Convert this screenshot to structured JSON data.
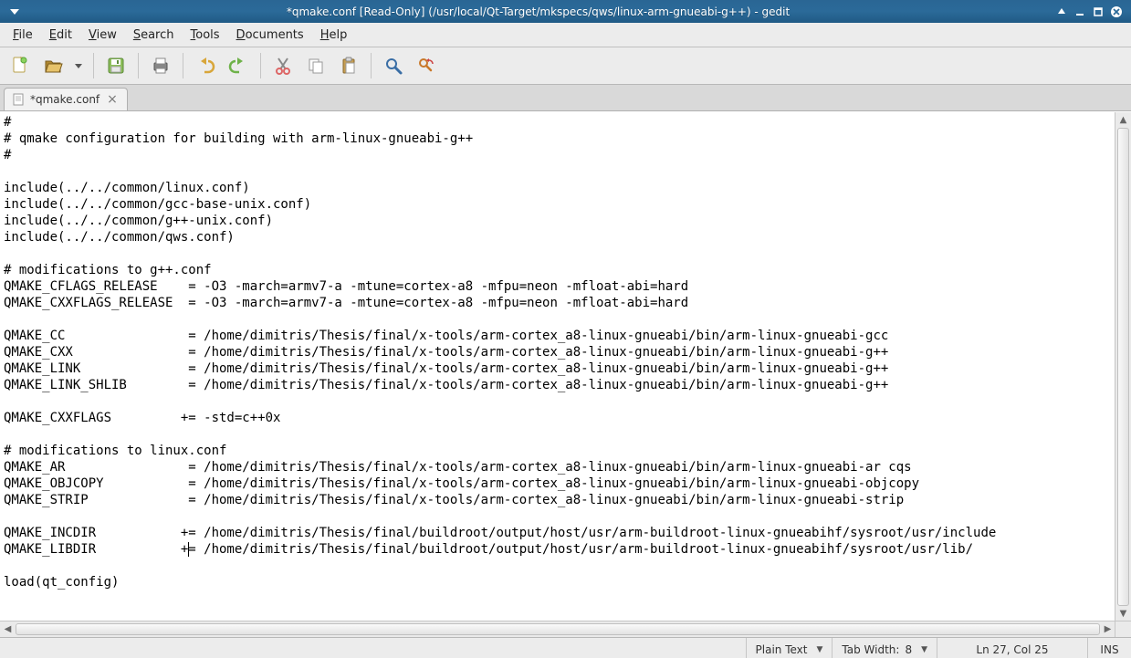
{
  "titlebar": {
    "title": "*qmake.conf [Read-Only] (/usr/local/Qt-Target/mkspecs/qws/linux-arm-gnueabi-g++) - gedit"
  },
  "menubar": {
    "items": [
      {
        "label": "File",
        "accel": "F"
      },
      {
        "label": "Edit",
        "accel": "E"
      },
      {
        "label": "View",
        "accel": "V"
      },
      {
        "label": "Search",
        "accel": "S"
      },
      {
        "label": "Tools",
        "accel": "T"
      },
      {
        "label": "Documents",
        "accel": "D"
      },
      {
        "label": "Help",
        "accel": "H"
      }
    ]
  },
  "toolbar": {
    "buttons": [
      {
        "name": "new-file-button",
        "icon": "new-file-icon"
      },
      {
        "name": "open-file-button",
        "icon": "open-file-icon",
        "dropdown": true
      },
      {
        "name": "sep"
      },
      {
        "name": "save-button",
        "icon": "save-icon"
      },
      {
        "name": "sep"
      },
      {
        "name": "print-button",
        "icon": "print-icon"
      },
      {
        "name": "sep"
      },
      {
        "name": "undo-button",
        "icon": "undo-icon"
      },
      {
        "name": "redo-button",
        "icon": "redo-icon"
      },
      {
        "name": "sep"
      },
      {
        "name": "cut-button",
        "icon": "cut-icon"
      },
      {
        "name": "copy-button",
        "icon": "copy-icon"
      },
      {
        "name": "paste-button",
        "icon": "paste-icon"
      },
      {
        "name": "sep"
      },
      {
        "name": "find-button",
        "icon": "find-icon"
      },
      {
        "name": "find-replace-button",
        "icon": "find-replace-icon"
      }
    ]
  },
  "tabs": {
    "items": [
      {
        "label": "*qmake.conf"
      }
    ]
  },
  "editor": {
    "lines": [
      "#",
      "# qmake configuration for building with arm-linux-gnueabi-g++",
      "#",
      "",
      "include(../../common/linux.conf)",
      "include(../../common/gcc-base-unix.conf)",
      "include(../../common/g++-unix.conf)",
      "include(../../common/qws.conf)",
      "",
      "# modifications to g++.conf",
      "QMAKE_CFLAGS_RELEASE    = -O3 -march=armv7-a -mtune=cortex-a8 -mfpu=neon -mfloat-abi=hard",
      "QMAKE_CXXFLAGS_RELEASE  = -O3 -march=armv7-a -mtune=cortex-a8 -mfpu=neon -mfloat-abi=hard",
      "",
      "QMAKE_CC                = /home/dimitris/Thesis/final/x-tools/arm-cortex_a8-linux-gnueabi/bin/arm-linux-gnueabi-gcc",
      "QMAKE_CXX               = /home/dimitris/Thesis/final/x-tools/arm-cortex_a8-linux-gnueabi/bin/arm-linux-gnueabi-g++",
      "QMAKE_LINK              = /home/dimitris/Thesis/final/x-tools/arm-cortex_a8-linux-gnueabi/bin/arm-linux-gnueabi-g++",
      "QMAKE_LINK_SHLIB        = /home/dimitris/Thesis/final/x-tools/arm-cortex_a8-linux-gnueabi/bin/arm-linux-gnueabi-g++",
      "",
      "QMAKE_CXXFLAGS         += -std=c++0x",
      "",
      "# modifications to linux.conf",
      "QMAKE_AR                = /home/dimitris/Thesis/final/x-tools/arm-cortex_a8-linux-gnueabi/bin/arm-linux-gnueabi-ar cqs",
      "QMAKE_OBJCOPY           = /home/dimitris/Thesis/final/x-tools/arm-cortex_a8-linux-gnueabi/bin/arm-linux-gnueabi-objcopy",
      "QMAKE_STRIP             = /home/dimitris/Thesis/final/x-tools/arm-cortex_a8-linux-gnueabi/bin/arm-linux-gnueabi-strip",
      "",
      "QMAKE_INCDIR           += /home/dimitris/Thesis/final/buildroot/output/host/usr/arm-buildroot-linux-gnueabihf/sysroot/usr/include",
      "QMAKE_LIBDIR           += /home/dimitris/Thesis/final/buildroot/output/host/usr/arm-buildroot-linux-gnueabihf/sysroot/usr/lib/",
      "",
      "load(qt_config)"
    ],
    "cursor": {
      "line": 27,
      "col": 25
    }
  },
  "statusbar": {
    "language": "Plain Text",
    "tabwidth_label": "Tab Width:",
    "tabwidth_value": "8",
    "position": "Ln 27, Col 25",
    "insert_mode": "INS"
  }
}
